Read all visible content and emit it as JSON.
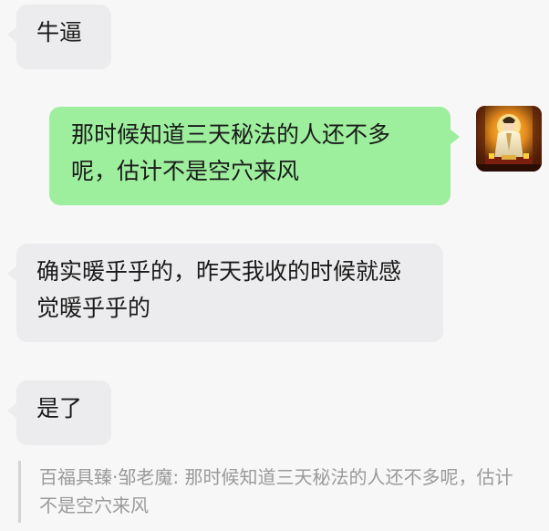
{
  "messages": [
    {
      "direction": "incoming",
      "text": "牛逼"
    },
    {
      "direction": "outgoing",
      "text": "那时候知道三天秘法的人还不多呢，估计不是空穴来风"
    },
    {
      "direction": "incoming",
      "text": "确实暖乎乎的，昨天我收的时候就感觉暖乎乎的"
    },
    {
      "direction": "incoming",
      "text": "是了"
    }
  ],
  "quote": {
    "sender": "百福具臻·邹老魔",
    "separator": ": ",
    "text": "那时候知道三天秘法的人还不多呢，估计不是空穴来风"
  },
  "colors": {
    "background": "#f7f7f7",
    "incoming_bubble": "#ececee",
    "outgoing_bubble": "#9def9d",
    "quote_text": "#9a9a9a"
  },
  "icons": {
    "avatar": "deity-statue-avatar"
  }
}
